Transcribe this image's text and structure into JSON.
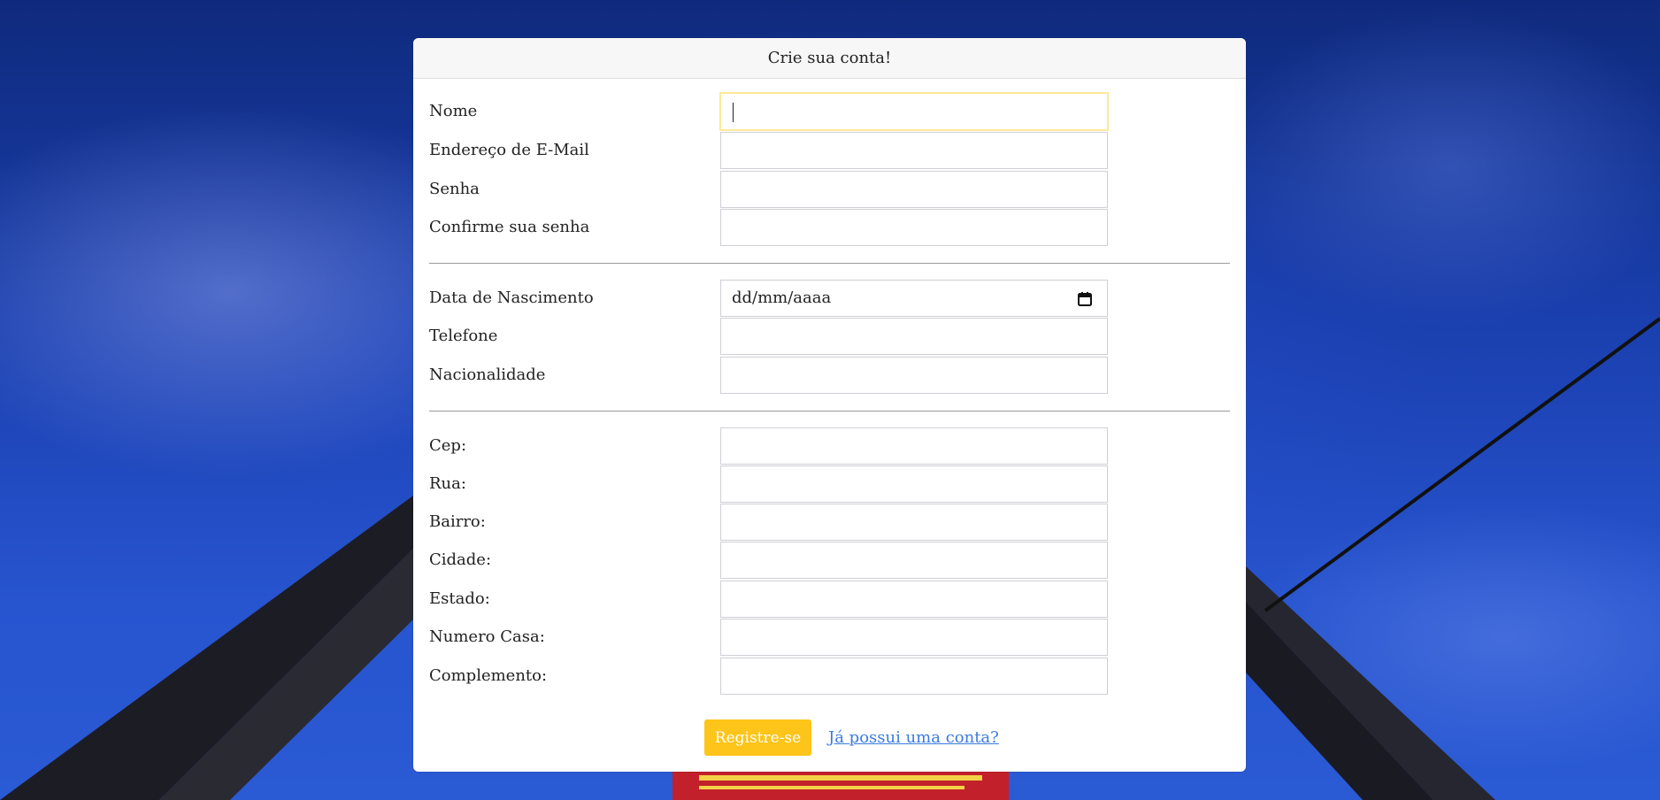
{
  "form": {
    "title": "Crie sua conta!",
    "account_fields": [
      {
        "label": "Nome",
        "value": ""
      },
      {
        "label": "Endereço de E-Mail",
        "value": ""
      },
      {
        "label": "Senha",
        "value": ""
      },
      {
        "label": "Confirme sua senha",
        "value": ""
      }
    ],
    "personal_fields": [
      {
        "label": "Data de Nascimento",
        "placeholder": "dd/mm/aaaa"
      },
      {
        "label": "Telefone",
        "value": ""
      },
      {
        "label": "Nacionalidade",
        "value": ""
      }
    ],
    "address_fields": [
      {
        "label": "Cep:",
        "value": ""
      },
      {
        "label": "Rua:",
        "value": ""
      },
      {
        "label": "Bairro:",
        "value": ""
      },
      {
        "label": "Cidade:",
        "value": ""
      },
      {
        "label": "Estado:",
        "value": ""
      },
      {
        "label": "Numero Casa:",
        "value": ""
      },
      {
        "label": "Complemento:",
        "value": ""
      }
    ],
    "submit_label": "Registre-se",
    "login_link": "Já possui uma conta?"
  },
  "icons": {
    "date_picker": "calendar-icon"
  },
  "colors": {
    "accent": "#fdc419",
    "link": "#3a7be0",
    "focus": "#fde99a"
  }
}
